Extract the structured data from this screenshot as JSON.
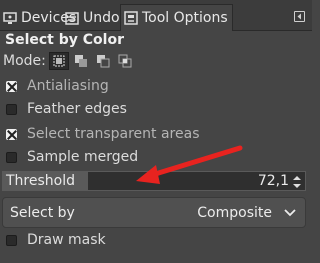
{
  "tabs": [
    {
      "label": "Devices",
      "icon": "devices-icon"
    },
    {
      "label": "Undo",
      "icon": "undo-icon"
    },
    {
      "label": "Tool Options",
      "icon": "tool-options-icon"
    }
  ],
  "panel": {
    "title": "Select by Color",
    "mode_label": "Mode:",
    "modes": [
      "replace",
      "add",
      "subtract",
      "intersect"
    ],
    "active_mode": "replace",
    "options": [
      {
        "label": "Antialiasing",
        "checked": true,
        "enabled": false
      },
      {
        "label": "Feather edges",
        "checked": false,
        "enabled": true
      },
      {
        "label": "Select transparent areas",
        "checked": true,
        "enabled": false
      },
      {
        "label": "Sample merged",
        "checked": false,
        "enabled": true
      }
    ],
    "threshold": {
      "label": "Threshold",
      "value": "72,1",
      "fraction": 0.28
    },
    "select_by": {
      "label": "Select by",
      "value": "Composite"
    },
    "draw_mask": {
      "label": "Draw mask",
      "checked": false
    }
  },
  "colors": {
    "annotation_arrow": "#e8231f",
    "panel_bg": "#454545"
  }
}
